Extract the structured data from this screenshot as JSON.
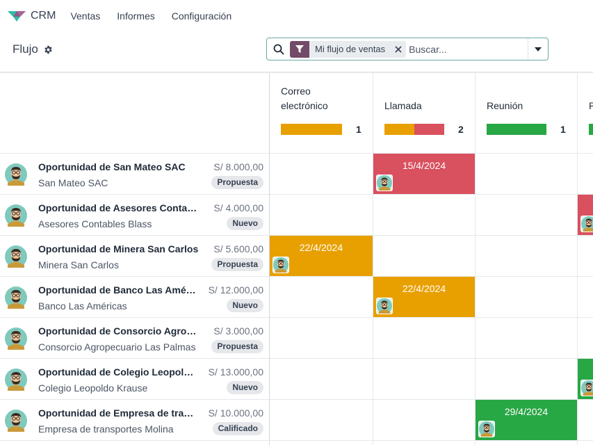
{
  "app": {
    "name": "CRM",
    "menu": [
      "Ventas",
      "Informes",
      "Configuración"
    ]
  },
  "breadcrumb": {
    "title": "Flujo"
  },
  "search": {
    "facet": "Mi flujo de ventas",
    "placeholder": "Buscar..."
  },
  "colors": {
    "orange": "#e8a000",
    "red": "#d9505e",
    "green": "#28a745",
    "brand": "#714b67"
  },
  "stages": [
    {
      "title": "Correo electrónico",
      "count": "1",
      "bar": [
        {
          "color": "#e8a000",
          "fraction": 1.0
        }
      ]
    },
    {
      "title": "Llamada",
      "count": "2",
      "bar": [
        {
          "color": "#e8a000",
          "fraction": 0.5
        },
        {
          "color": "#d9505e",
          "fraction": 0.5
        }
      ]
    },
    {
      "title": "Reunión",
      "count": "1",
      "bar": [
        {
          "color": "#28a745",
          "fraction": 1.0
        }
      ]
    },
    {
      "title": "P",
      "count": "",
      "bar": [
        {
          "color": "#28a745",
          "fraction": 1.0
        }
      ]
    }
  ],
  "rows": [
    {
      "title": "Oportunidad de San Mateo SAC",
      "subtitle": "San Mateo SAC",
      "amount": "S/ 8.000,00",
      "stage": "Propuesta"
    },
    {
      "title": "Oportunidad de Asesores Contables Blass",
      "subtitle": "Asesores Contables Blass",
      "amount": "S/ 4.000,00",
      "stage": "Nuevo"
    },
    {
      "title": "Oportunidad de Minera San Carlos",
      "subtitle": "Minera San Carlos",
      "amount": "S/ 5.600,00",
      "stage": "Propuesta"
    },
    {
      "title": "Oportunidad de Banco Las Américas",
      "subtitle": "Banco Las Américas",
      "amount": "S/ 12.000,00",
      "stage": "Nuevo"
    },
    {
      "title": "Oportunidad de Consorcio Agropecuario Las Palmas",
      "subtitle": "Consorcio Agropecuario Las Palmas",
      "amount": "S/ 3.000,00",
      "stage": "Propuesta"
    },
    {
      "title": "Oportunidad de Colegio Leopoldo Krause",
      "subtitle": "Colegio Leopoldo Krause",
      "amount": "S/ 13.000,00",
      "stage": "Nuevo"
    },
    {
      "title": "Oportunidad de Empresa de transportes Molina",
      "subtitle": "Empresa de transportes Molina",
      "amount": "S/ 10.000,00",
      "stage": "Calificado"
    }
  ],
  "activities": [
    {
      "row": 0,
      "stage": 1,
      "date": "15/4/2024",
      "color": "#d9505e"
    },
    {
      "row": 1,
      "stage": 3,
      "date": "",
      "color": "#d9505e"
    },
    {
      "row": 2,
      "stage": 0,
      "date": "22/4/2024",
      "color": "#e8a000"
    },
    {
      "row": 3,
      "stage": 1,
      "date": "22/4/2024",
      "color": "#e8a000"
    },
    {
      "row": 5,
      "stage": 3,
      "date": "",
      "color": "#28a745"
    },
    {
      "row": 6,
      "stage": 2,
      "date": "29/4/2024",
      "color": "#28a745"
    }
  ]
}
